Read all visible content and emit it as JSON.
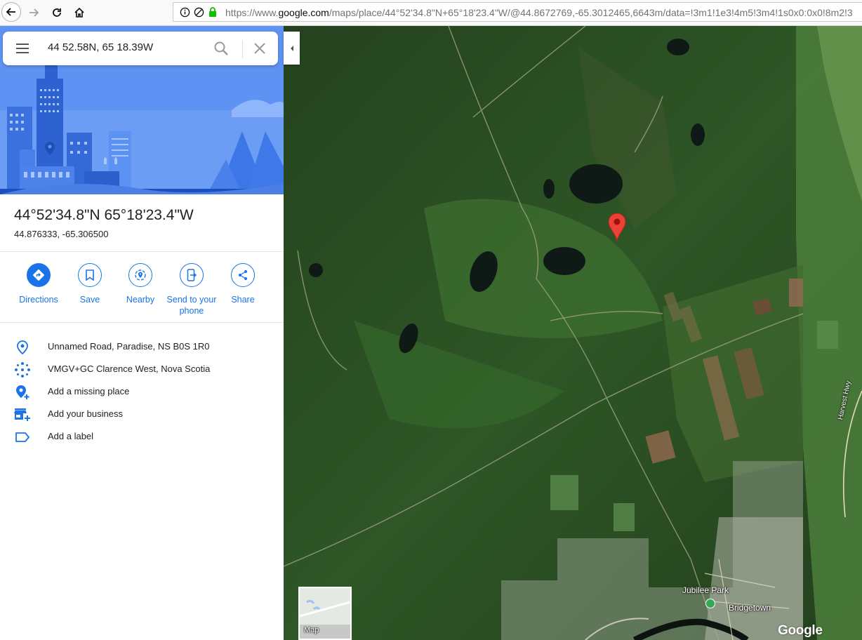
{
  "browser": {
    "url_prefix": "https://www.",
    "url_host": "google.com",
    "url_path": "/maps/place/44°52'34.8\"N+65°18'23.4\"W/@44.8672769,-65.3012465,6643m/data=!3m1!1e3!4m5!3m4!1s0x0:0x0!8m2!3"
  },
  "search": {
    "query": "44 52.58N, 65 18.39W"
  },
  "place": {
    "title": "44°52'34.8\"N 65°18'23.4\"W",
    "decimal": "44.876333, -65.306500"
  },
  "actions": [
    {
      "label": "Directions"
    },
    {
      "label": "Save"
    },
    {
      "label": "Nearby"
    },
    {
      "label": "Send to your phone"
    },
    {
      "label": "Share"
    }
  ],
  "details": [
    {
      "icon": "location-pin-icon",
      "text": "Unnamed Road, Paradise, NS B0S 1R0"
    },
    {
      "icon": "plus-code-icon",
      "text": "VMGV+GC Clarence West, Nova Scotia"
    },
    {
      "icon": "add-place-icon",
      "text": "Add a missing place"
    },
    {
      "icon": "add-business-icon",
      "text": "Add your business"
    },
    {
      "icon": "label-icon",
      "text": "Add a label"
    }
  ],
  "map": {
    "minimap_label": "Map",
    "place_labels": [
      "Jubilee Park",
      "Bridgetown",
      "Harvest Hwy"
    ],
    "logo": "Google",
    "accent": "#1a73e8",
    "pin_color": "#ea4335"
  }
}
